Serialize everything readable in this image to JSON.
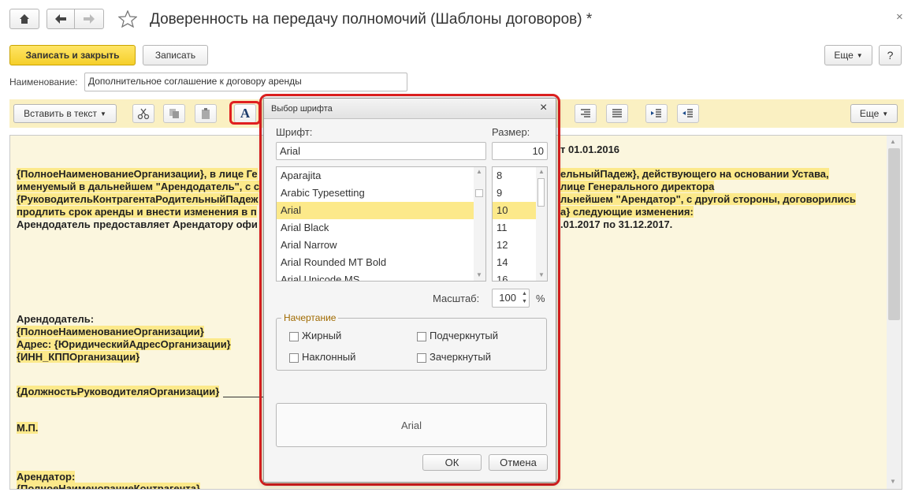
{
  "window": {
    "title": "Доверенность на передачу полномочий (Шаблоны договоров) *",
    "close_glyph": "×"
  },
  "nav": {
    "home_icon": "home-icon",
    "back_icon": "arrow-left-icon",
    "forward_icon": "arrow-right-icon",
    "favorite_icon": "star-icon"
  },
  "actions": {
    "save_close": "Записать и закрыть",
    "save": "Записать",
    "more": "Еще",
    "help": "?"
  },
  "name_field": {
    "label": "Наименование:",
    "value": "Дополнительное соглашение к договору аренды"
  },
  "toolbar": {
    "insert": "Вставить в текст",
    "more": "Еще",
    "font_button": "A"
  },
  "document": {
    "header_fragment": "т 01.01.2016",
    "lines": [
      {
        "left": "{ПолноеНаименованиеОрганизации}, в лице Ге",
        "right": "ельныйПадеж}, действующего на основании Устава,"
      },
      {
        "left": "именуемый в дальнейшем \"Арендодатель\", с с",
        "right": "лице Генерального директора"
      },
      {
        "left": "{РуководительКонтрагентаРодительныйПадеж",
        "right": "льнейшем \"Арендатор\", с другой стороны, договорились"
      },
      {
        "left": "продлить срок аренды и внести изменения в п",
        "right": "а} следующие изменения:"
      },
      {
        "left": "Арендодатель предоставляет Арендатору офи",
        "right": ".01.2017 по 31.12.2017."
      }
    ],
    "landlord": "Арендодатель:",
    "landlord_org": "{ПолноеНаименованиеОрганизации}",
    "address": "Адрес: {ЮридическийАдресОрганизации}",
    "inn": "{ИНН_КППОрганизации}",
    "position": "{ДолжностьРуководителяОрганизации}",
    "mp": "М.П.",
    "tenant": "Арендатор:",
    "tenant_org": "{ПолноеНаименованиеКонтрагента}"
  },
  "dialog": {
    "title": "Выбор шрифта",
    "font_label": "Шрифт:",
    "size_label": "Размер:",
    "font_value": "Arial",
    "size_value": "10",
    "fonts": [
      "Aparajita",
      "Arabic Typesetting",
      "Arial",
      "Arial Black",
      "Arial Narrow",
      "Arial Rounded MT Bold",
      "Arial Unicode MS"
    ],
    "selected_font": "Arial",
    "sizes": [
      "8",
      "9",
      "10",
      "11",
      "12",
      "14",
      "16"
    ],
    "selected_size": "10",
    "scale_label": "Масштаб:",
    "scale_value": "100",
    "scale_unit": "%",
    "style_group": "Начертание",
    "bold": "Жирный",
    "italic": "Наклонный",
    "underline": "Подчеркнутый",
    "strike": "Зачеркнутый",
    "preview": "Arial",
    "ok": "ОК",
    "cancel": "Отмена"
  },
  "colors": {
    "accent": "#f5cf2a",
    "highlight": "#fce98a",
    "annotation": "#e02020"
  }
}
